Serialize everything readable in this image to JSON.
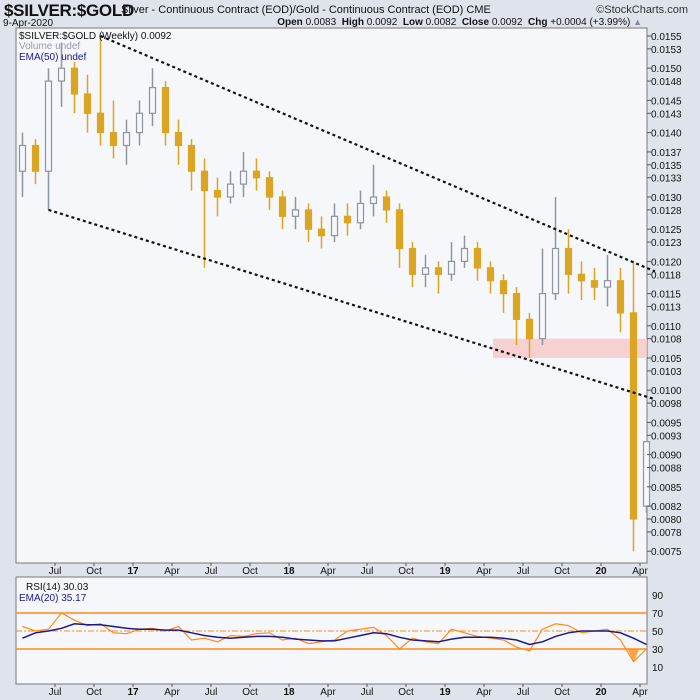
{
  "header": {
    "symbol": "$SILVER:$GOLD",
    "description": "Silver - Continuous Contract (EOD)/Gold - Continuous Contract (EOD)",
    "exchange": "CME",
    "brand": "©StockCharts.com",
    "date": "9-Apr-2020",
    "open_label": "Open",
    "open": "0.0083",
    "high_label": "High",
    "high": "0.0092",
    "low_label": "Low",
    "low": "0.0082",
    "close_label": "Close",
    "close": "0.0092",
    "chg_label": "Chg",
    "chg": "+0.0004 (+3.99%)"
  },
  "legend": {
    "price": "$SILVER:$GOLD (Weekly) 0.0092",
    "volume": "Volume undef",
    "ema": "EMA(50) undef",
    "rsi": "RSI(14) 30.03",
    "rsi_ema": "EMA(20) 35.17"
  },
  "colors": {
    "up": "#8c969c",
    "down": "#daa520",
    "ema": "#1a1a8c",
    "rsi": "#ff8c1a",
    "band": "#f7c6c8",
    "trendline": "#111111"
  },
  "chart_data": [
    {
      "type": "candlestick",
      "title": "$SILVER:$GOLD (Weekly)",
      "ylim": [
        0.0074,
        0.0156
      ],
      "yticks": [
        "0.0155",
        "0.0153",
        "0.0150",
        "0.0148",
        "0.0145",
        "0.0143",
        "0.0140",
        "0.0137",
        "0.0135",
        "0.0133",
        "0.0130",
        "0.0128",
        "0.0125",
        "0.0123",
        "0.0120",
        "0.0118",
        "0.0115",
        "0.0113",
        "0.0110",
        "0.0108",
        "0.0105",
        "0.0103",
        "0.0100",
        "0.0098",
        "0.0095",
        "0.0093",
        "0.0090",
        "0.0088",
        "0.0085",
        "0.0082",
        "0.0080",
        "0.0078",
        "0.0075"
      ],
      "xticks": [
        [
          "2016-07",
          "Jul"
        ],
        [
          "2016-10",
          "Oct"
        ],
        [
          "2017-01",
          "17"
        ],
        [
          "2017-04",
          "Apr"
        ],
        [
          "2017-07",
          "Jul"
        ],
        [
          "2017-10",
          "Oct"
        ],
        [
          "2018-01",
          "18"
        ],
        [
          "2018-04",
          "Apr"
        ],
        [
          "2018-07",
          "Jul"
        ],
        [
          "2018-10",
          "Oct"
        ],
        [
          "2019-01",
          "19"
        ],
        [
          "2019-04",
          "Apr"
        ],
        [
          "2019-07",
          "Jul"
        ],
        [
          "2019-10",
          "Oct"
        ],
        [
          "2020-01",
          "20"
        ],
        [
          "2020-04",
          "Apr"
        ]
      ],
      "grid": false,
      "ohlc": [
        [
          "2016-04",
          0.0134,
          0.014,
          0.013,
          0.0138
        ],
        [
          "2016-05",
          0.0138,
          0.0139,
          0.0132,
          0.0134
        ],
        [
          "2016-06",
          0.0134,
          0.015,
          0.0128,
          0.0148
        ],
        [
          "2016-07",
          0.0148,
          0.0154,
          0.0144,
          0.015
        ],
        [
          "2016-08",
          0.015,
          0.0151,
          0.0143,
          0.0146
        ],
        [
          "2016-09",
          0.0146,
          0.0149,
          0.014,
          0.0143
        ],
        [
          "2016-10",
          0.0143,
          0.0155,
          0.0138,
          0.014
        ],
        [
          "2016-11",
          0.014,
          0.0145,
          0.0136,
          0.0138
        ],
        [
          "2016-12",
          0.0138,
          0.0142,
          0.0135,
          0.014
        ],
        [
          "2017-01",
          0.014,
          0.0145,
          0.0138,
          0.0143
        ],
        [
          "2017-02",
          0.0143,
          0.015,
          0.0141,
          0.0147
        ],
        [
          "2017-03",
          0.0147,
          0.0148,
          0.0138,
          0.014
        ],
        [
          "2017-04",
          0.014,
          0.0142,
          0.0135,
          0.0138
        ],
        [
          "2017-05",
          0.0138,
          0.0139,
          0.0131,
          0.0134
        ],
        [
          "2017-06",
          0.0134,
          0.0136,
          0.0119,
          0.0131
        ],
        [
          "2017-07",
          0.0131,
          0.0133,
          0.0127,
          0.013
        ],
        [
          "2017-08",
          0.013,
          0.0134,
          0.0129,
          0.0132
        ],
        [
          "2017-09",
          0.0132,
          0.0137,
          0.013,
          0.0134
        ],
        [
          "2017-10",
          0.0134,
          0.0136,
          0.0131,
          0.0133
        ],
        [
          "2017-11",
          0.0133,
          0.0134,
          0.0128,
          0.013
        ],
        [
          "2017-12",
          0.013,
          0.0131,
          0.0125,
          0.0127
        ],
        [
          "2018-01",
          0.0127,
          0.013,
          0.0125,
          0.0128
        ],
        [
          "2018-02",
          0.0128,
          0.0129,
          0.0123,
          0.0125
        ],
        [
          "2018-03",
          0.0125,
          0.0127,
          0.0122,
          0.0124
        ],
        [
          "2018-04",
          0.0124,
          0.0129,
          0.0123,
          0.0127
        ],
        [
          "2018-05",
          0.0127,
          0.0129,
          0.0124,
          0.0126
        ],
        [
          "2018-06",
          0.0126,
          0.0131,
          0.0125,
          0.0129
        ],
        [
          "2018-07",
          0.0129,
          0.0135,
          0.0127,
          0.013
        ],
        [
          "2018-08",
          0.013,
          0.0131,
          0.0126,
          0.0128
        ],
        [
          "2018-09",
          0.0128,
          0.0129,
          0.0119,
          0.0122
        ],
        [
          "2018-10",
          0.0122,
          0.0123,
          0.0116,
          0.0118
        ],
        [
          "2018-11",
          0.0118,
          0.0121,
          0.0116,
          0.0119
        ],
        [
          "2018-12",
          0.0119,
          0.012,
          0.0115,
          0.0118
        ],
        [
          "2019-01",
          0.0118,
          0.0123,
          0.0117,
          0.012
        ],
        [
          "2019-02",
          0.012,
          0.0124,
          0.0119,
          0.0122
        ],
        [
          "2019-03",
          0.0122,
          0.0123,
          0.0117,
          0.0119
        ],
        [
          "2019-04",
          0.0119,
          0.012,
          0.0115,
          0.0117
        ],
        [
          "2019-05",
          0.0117,
          0.0118,
          0.0112,
          0.0115
        ],
        [
          "2019-06",
          0.0115,
          0.0116,
          0.0107,
          0.0111
        ],
        [
          "2019-07",
          0.0111,
          0.0112,
          0.0105,
          0.0108
        ],
        [
          "2019-08",
          0.0108,
          0.0122,
          0.0107,
          0.0115
        ],
        [
          "2019-09",
          0.0115,
          0.013,
          0.0114,
          0.0122
        ],
        [
          "2019-10",
          0.0122,
          0.0125,
          0.0115,
          0.0118
        ],
        [
          "2019-11",
          0.0118,
          0.012,
          0.0114,
          0.0117
        ],
        [
          "2019-12",
          0.0117,
          0.0119,
          0.0114,
          0.0116
        ],
        [
          "2020-01",
          0.0116,
          0.0121,
          0.0113,
          0.0117
        ],
        [
          "2020-02",
          0.0117,
          0.0119,
          0.0109,
          0.0112
        ],
        [
          "2020-03",
          0.0112,
          0.012,
          0.0075,
          0.008
        ],
        [
          "2020-04",
          0.0082,
          0.0092,
          0.0081,
          0.0092
        ]
      ],
      "trendlines": [
        {
          "from": [
            "2016-10",
            0.0155
          ],
          "to": [
            "2020-04",
            0.0119
          ]
        },
        {
          "from": [
            "2016-06",
            0.0128
          ],
          "to": [
            "2020-04",
            0.0099
          ]
        }
      ],
      "band": {
        "from": "2019-05",
        "to": "2020-04",
        "low": 0.0105,
        "high": 0.0108
      }
    },
    {
      "type": "line",
      "title": "RSI(14)",
      "ylim": [
        0,
        100
      ],
      "yticks": [
        "90",
        "70",
        "50",
        "30",
        "10"
      ],
      "levels": [
        70,
        50,
        30
      ],
      "series": [
        {
          "name": "RSI(14)",
          "values": [
            55,
            50,
            52,
            70,
            62,
            56,
            58,
            48,
            47,
            52,
            53,
            50,
            55,
            40,
            42,
            38,
            45,
            44,
            47,
            48,
            40,
            42,
            36,
            38,
            40,
            50,
            52,
            54,
            45,
            30,
            42,
            38,
            36,
            52,
            48,
            44,
            42,
            40,
            32,
            28,
            52,
            58,
            56,
            48,
            50,
            52,
            40,
            16,
            30
          ]
        },
        {
          "name": "EMA(20)",
          "values": [
            42,
            48,
            50,
            53,
            58,
            57,
            57,
            55,
            53,
            52,
            52,
            51,
            51,
            48,
            45,
            43,
            42,
            43,
            44,
            44,
            43,
            41,
            40,
            39,
            39,
            42,
            45,
            48,
            47,
            43,
            40,
            39,
            38,
            41,
            43,
            43,
            43,
            42,
            40,
            35,
            38,
            44,
            48,
            50,
            50,
            50,
            48,
            42,
            35
          ]
        }
      ]
    }
  ]
}
